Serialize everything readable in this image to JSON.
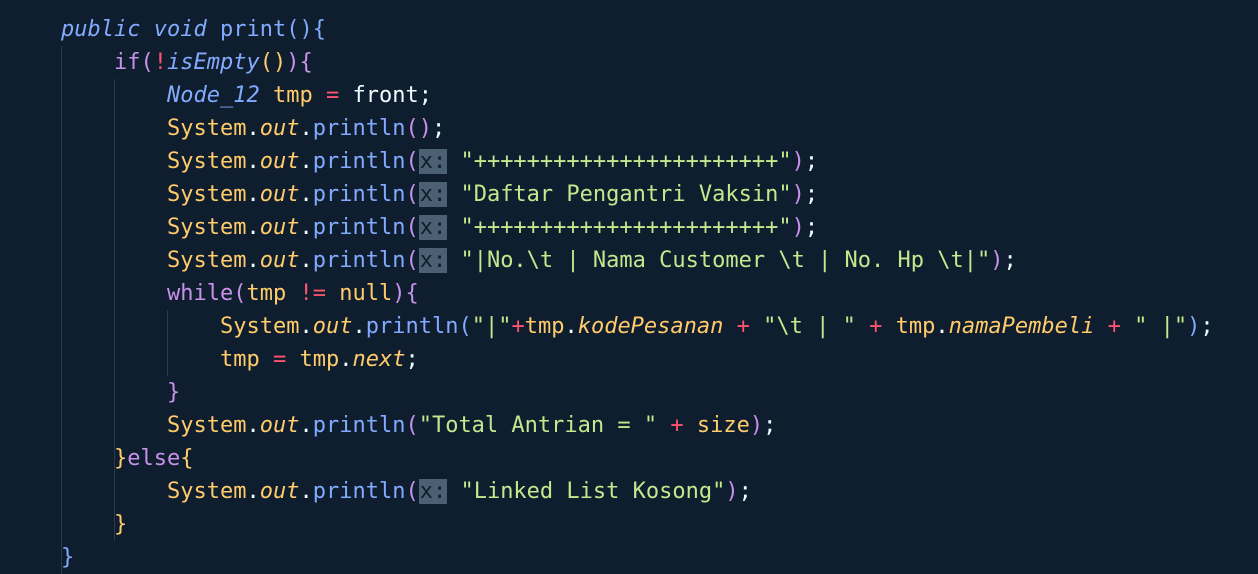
{
  "editor": {
    "lines": [
      {
        "id": "l1",
        "tokens": [
          {
            "cls": "kwb",
            "t": "public"
          },
          {
            "cls": "plain",
            "t": " "
          },
          {
            "cls": "kwb",
            "t": "void"
          },
          {
            "cls": "plain",
            "t": " "
          },
          {
            "cls": "fn",
            "t": "print"
          },
          {
            "cls": "b1",
            "t": "()"
          },
          {
            "cls": "b1",
            "t": "{"
          }
        ]
      },
      {
        "id": "l2",
        "tokens": [
          {
            "cls": "kw",
            "t": "if"
          },
          {
            "cls": "b2",
            "t": "("
          },
          {
            "cls": "op",
            "t": "!"
          },
          {
            "cls": "fni",
            "t": "isEmpty"
          },
          {
            "cls": "b3",
            "t": "()"
          },
          {
            "cls": "b2",
            "t": ")"
          },
          {
            "cls": "b2",
            "t": "{"
          }
        ]
      },
      {
        "id": "l3",
        "tokens": [
          {
            "cls": "typ",
            "t": "Node_12"
          },
          {
            "cls": "plain",
            "t": " "
          },
          {
            "cls": "var",
            "t": "tmp"
          },
          {
            "cls": "plain",
            "t": " "
          },
          {
            "cls": "op",
            "t": "="
          },
          {
            "cls": "plain",
            "t": " front;"
          }
        ]
      },
      {
        "id": "l4",
        "tokens": [
          {
            "cls": "var",
            "t": "System"
          },
          {
            "cls": "plain",
            "t": "."
          },
          {
            "cls": "field",
            "t": "out"
          },
          {
            "cls": "plain",
            "t": "."
          },
          {
            "cls": "fn",
            "t": "println"
          },
          {
            "cls": "b2",
            "t": "()"
          },
          {
            "cls": "plain",
            "t": ";"
          }
        ]
      },
      {
        "id": "l5",
        "tokens": [
          {
            "cls": "var",
            "t": "System"
          },
          {
            "cls": "plain",
            "t": "."
          },
          {
            "cls": "field",
            "t": "out"
          },
          {
            "cls": "plain",
            "t": "."
          },
          {
            "cls": "fn",
            "t": "println"
          },
          {
            "cls": "b2",
            "t": "("
          },
          {
            "cls": "hint",
            "t": "x:"
          },
          {
            "cls": "plain",
            "t": " "
          },
          {
            "cls": "str",
            "t": "\"+++++++++++++++++++++++\""
          },
          {
            "cls": "b2",
            "t": ")"
          },
          {
            "cls": "plain",
            "t": ";"
          }
        ]
      },
      {
        "id": "l6",
        "tokens": [
          {
            "cls": "var",
            "t": "System"
          },
          {
            "cls": "plain",
            "t": "."
          },
          {
            "cls": "field",
            "t": "out"
          },
          {
            "cls": "plain",
            "t": "."
          },
          {
            "cls": "fn",
            "t": "println"
          },
          {
            "cls": "b2",
            "t": "("
          },
          {
            "cls": "hint",
            "t": "x:"
          },
          {
            "cls": "plain",
            "t": " "
          },
          {
            "cls": "str",
            "t": "\"Daftar Pengantri Vaksin\""
          },
          {
            "cls": "b2",
            "t": ")"
          },
          {
            "cls": "plain",
            "t": ";"
          }
        ]
      },
      {
        "id": "l7",
        "tokens": [
          {
            "cls": "var",
            "t": "System"
          },
          {
            "cls": "plain",
            "t": "."
          },
          {
            "cls": "field",
            "t": "out"
          },
          {
            "cls": "plain",
            "t": "."
          },
          {
            "cls": "fn",
            "t": "println"
          },
          {
            "cls": "b2",
            "t": "("
          },
          {
            "cls": "hint",
            "t": "x:"
          },
          {
            "cls": "plain",
            "t": " "
          },
          {
            "cls": "str",
            "t": "\"+++++++++++++++++++++++\""
          },
          {
            "cls": "b2",
            "t": ")"
          },
          {
            "cls": "plain",
            "t": ";"
          }
        ]
      },
      {
        "id": "l8",
        "tokens": [
          {
            "cls": "var",
            "t": "System"
          },
          {
            "cls": "plain",
            "t": "."
          },
          {
            "cls": "field",
            "t": "out"
          },
          {
            "cls": "plain",
            "t": "."
          },
          {
            "cls": "fn",
            "t": "println"
          },
          {
            "cls": "b2",
            "t": "("
          },
          {
            "cls": "hint",
            "t": "x:"
          },
          {
            "cls": "plain",
            "t": " "
          },
          {
            "cls": "str",
            "t": "\"|No.\\t | Nama Customer \\t | No. Hp \\t|\""
          },
          {
            "cls": "b2",
            "t": ")"
          },
          {
            "cls": "plain",
            "t": ";"
          }
        ]
      },
      {
        "id": "l9",
        "tokens": [
          {
            "cls": "kw",
            "t": "while"
          },
          {
            "cls": "b2",
            "t": "("
          },
          {
            "cls": "var",
            "t": "tmp"
          },
          {
            "cls": "plain",
            "t": " "
          },
          {
            "cls": "op",
            "t": "!="
          },
          {
            "cls": "plain",
            "t": " "
          },
          {
            "cls": "var",
            "t": "null"
          },
          {
            "cls": "b2",
            "t": ")"
          },
          {
            "cls": "b2",
            "t": "{"
          }
        ]
      },
      {
        "id": "l10",
        "tokens": [
          {
            "cls": "var",
            "t": "System"
          },
          {
            "cls": "plain",
            "t": "."
          },
          {
            "cls": "field",
            "t": "out"
          },
          {
            "cls": "plain",
            "t": "."
          },
          {
            "cls": "fn",
            "t": "println"
          },
          {
            "cls": "b1",
            "t": "("
          },
          {
            "cls": "str",
            "t": "\"|\""
          },
          {
            "cls": "op",
            "t": "+"
          },
          {
            "cls": "var",
            "t": "tmp"
          },
          {
            "cls": "plain",
            "t": "."
          },
          {
            "cls": "field",
            "t": "kodePesanan"
          },
          {
            "cls": "plain",
            "t": " "
          },
          {
            "cls": "op",
            "t": "+"
          },
          {
            "cls": "plain",
            "t": " "
          },
          {
            "cls": "str",
            "t": "\"\\t | \""
          },
          {
            "cls": "plain",
            "t": " "
          },
          {
            "cls": "op",
            "t": "+"
          },
          {
            "cls": "plain",
            "t": " "
          },
          {
            "cls": "var",
            "t": "tmp"
          },
          {
            "cls": "plain",
            "t": "."
          },
          {
            "cls": "field",
            "t": "namaPembeli"
          },
          {
            "cls": "plain",
            "t": " "
          },
          {
            "cls": "op",
            "t": "+"
          },
          {
            "cls": "plain",
            "t": " "
          },
          {
            "cls": "str",
            "t": "\" |\""
          },
          {
            "cls": "b1",
            "t": ")"
          },
          {
            "cls": "plain",
            "t": ";"
          }
        ]
      },
      {
        "id": "l11",
        "tokens": [
          {
            "cls": "var",
            "t": "tmp"
          },
          {
            "cls": "plain",
            "t": " "
          },
          {
            "cls": "op",
            "t": "="
          },
          {
            "cls": "plain",
            "t": " "
          },
          {
            "cls": "var",
            "t": "tmp"
          },
          {
            "cls": "plain",
            "t": "."
          },
          {
            "cls": "field",
            "t": "next"
          },
          {
            "cls": "plain",
            "t": ";"
          }
        ]
      },
      {
        "id": "l12",
        "tokens": [
          {
            "cls": "b2",
            "t": "}"
          }
        ]
      },
      {
        "id": "l13",
        "tokens": [
          {
            "cls": "var",
            "t": "System"
          },
          {
            "cls": "plain",
            "t": "."
          },
          {
            "cls": "field",
            "t": "out"
          },
          {
            "cls": "plain",
            "t": "."
          },
          {
            "cls": "fn",
            "t": "println"
          },
          {
            "cls": "b2",
            "t": "("
          },
          {
            "cls": "str",
            "t": "\"Total Antrian = \""
          },
          {
            "cls": "plain",
            "t": " "
          },
          {
            "cls": "op",
            "t": "+"
          },
          {
            "cls": "plain",
            "t": " "
          },
          {
            "cls": "var",
            "t": "size"
          },
          {
            "cls": "b2",
            "t": ")"
          },
          {
            "cls": "plain",
            "t": ";"
          }
        ]
      },
      {
        "id": "l14",
        "tokens": [
          {
            "cls": "b3",
            "t": "}"
          },
          {
            "cls": "kw",
            "t": "else"
          },
          {
            "cls": "b3",
            "t": "{"
          }
        ]
      },
      {
        "id": "l15",
        "tokens": [
          {
            "cls": "var",
            "t": "System"
          },
          {
            "cls": "plain",
            "t": "."
          },
          {
            "cls": "field",
            "t": "out"
          },
          {
            "cls": "plain",
            "t": "."
          },
          {
            "cls": "fn",
            "t": "println"
          },
          {
            "cls": "b2",
            "t": "("
          },
          {
            "cls": "hint",
            "t": "x:"
          },
          {
            "cls": "plain",
            "t": " "
          },
          {
            "cls": "str",
            "t": "\"Linked List Kosong\""
          },
          {
            "cls": "b2",
            "t": ")"
          },
          {
            "cls": "plain",
            "t": ";"
          }
        ]
      },
      {
        "id": "l16",
        "tokens": [
          {
            "cls": "b3",
            "t": "}"
          }
        ]
      },
      {
        "id": "l17",
        "tokens": [
          {
            "cls": "b1",
            "t": "}"
          }
        ]
      }
    ]
  }
}
